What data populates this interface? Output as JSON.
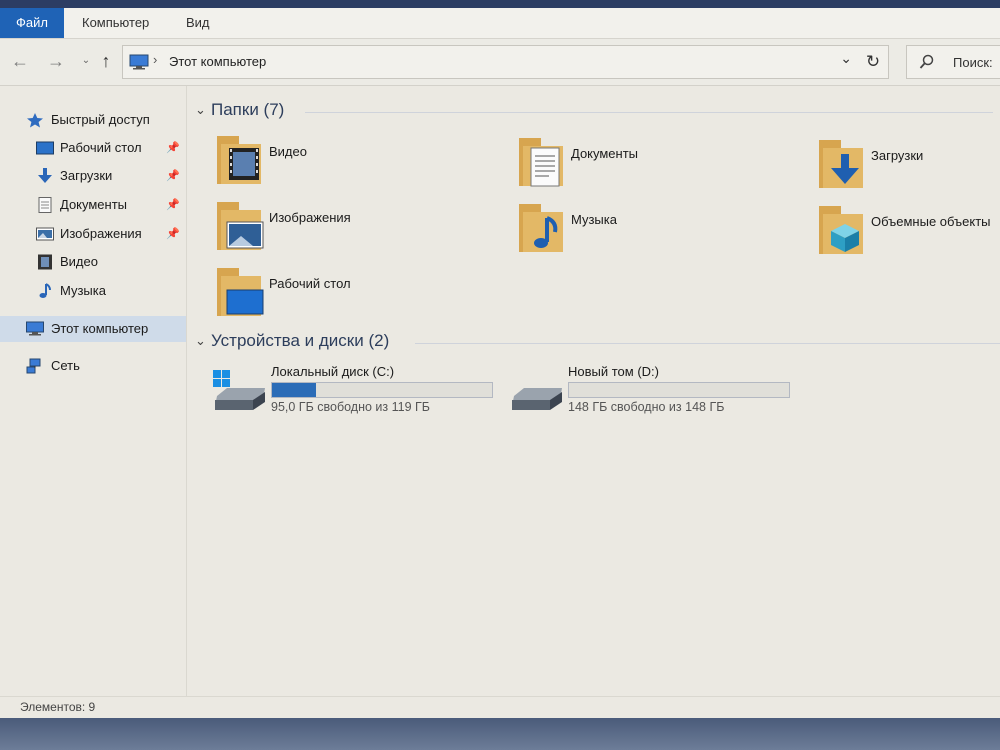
{
  "ribbon": {
    "tabs": [
      {
        "label": "Файл"
      },
      {
        "label": "Компьютер"
      },
      {
        "label": "Вид"
      }
    ]
  },
  "nav": {
    "path": "Этот компьютер",
    "search_placeholder": "Поиск:"
  },
  "sidebar": {
    "quick_access": "Быстрый доступ",
    "pinned": [
      {
        "label": "Рабочий стол",
        "pinned": true
      },
      {
        "label": "Загрузки",
        "pinned": true
      },
      {
        "label": "Документы",
        "pinned": true
      },
      {
        "label": "Изображения",
        "pinned": true
      },
      {
        "label": "Видео",
        "pinned": false
      },
      {
        "label": "Музыка",
        "pinned": false
      }
    ],
    "this_pc": "Этот компьютер",
    "network": "Сеть"
  },
  "content": {
    "folders_header": "Папки (7)",
    "folders": [
      {
        "name": "Видео",
        "icon": "video-folder-icon"
      },
      {
        "name": "Документы",
        "icon": "documents-folder-icon"
      },
      {
        "name": "Загрузки",
        "icon": "downloads-folder-icon"
      },
      {
        "name": "Изображения",
        "icon": "pictures-folder-icon"
      },
      {
        "name": "Музыка",
        "icon": "music-folder-icon"
      },
      {
        "name": "Объемные объекты",
        "icon": "3d-objects-folder-icon"
      },
      {
        "name": "Рабочий стол",
        "icon": "desktop-folder-icon"
      }
    ],
    "drives_header": "Устройства и диски (2)",
    "drives": [
      {
        "name": "Локальный диск (C:)",
        "free": "95,0 ГБ свободно из 119 ГБ",
        "used_fraction": 0.2
      },
      {
        "name": "Новый том (D:)",
        "free": "148 ГБ свободно из 148 ГБ",
        "used_fraction": 0.0
      }
    ]
  },
  "status": {
    "items": "Элементов: 9"
  },
  "colors": {
    "accent": "#1f63b6",
    "drive_bar": "#2b6cb7"
  }
}
